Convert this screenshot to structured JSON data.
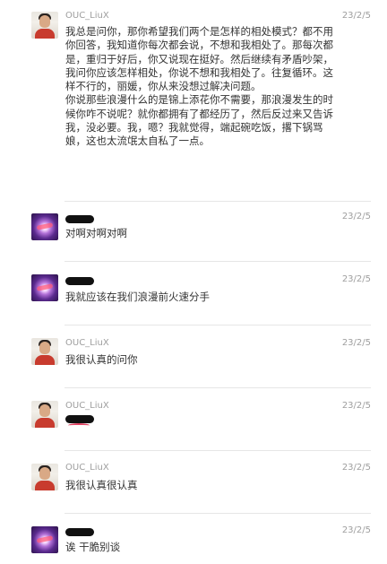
{
  "messages": [
    {
      "sender": "OUC_LiuX",
      "date": "23/2/5",
      "text": "我总是问你，那你希望我们两个是怎样的相处模式？都不用你回答，我知道你每次都会说，不想和我相处了。那每次都是，重归于好后，你又说现在挺好。然后继续有矛盾吵架，我问你应该怎样相处，你说不想和我相处了。往复循环。这样不行的，丽媛，你从来没想过解决问题。\n你说那些浪漫什么的是锦上添花你不需要，那浪漫发生的时候你咋不说呢？就你都拥有了都经历了，然后反过来又告诉我，没必要。我，嗯？我就觉得，端起碗吃饭，撂下锅骂娘，这也太流氓太自私了一点。"
    },
    {
      "sender": "",
      "date": "23/2/5",
      "text": "对啊对啊对啊"
    },
    {
      "sender": "",
      "date": "23/2/5",
      "text": "我就应该在我们浪漫前火速分手"
    },
    {
      "sender": "OUC_LiuX",
      "date": "23/2/5",
      "text": "我很认真的问你"
    },
    {
      "sender": "OUC_LiuX",
      "date": "23/2/5",
      "text": ""
    },
    {
      "sender": "OUC_LiuX",
      "date": "23/2/5",
      "text": "我很认真很认真"
    },
    {
      "sender": "",
      "date": "23/2/5",
      "text": "诶 干脆别谈"
    }
  ]
}
